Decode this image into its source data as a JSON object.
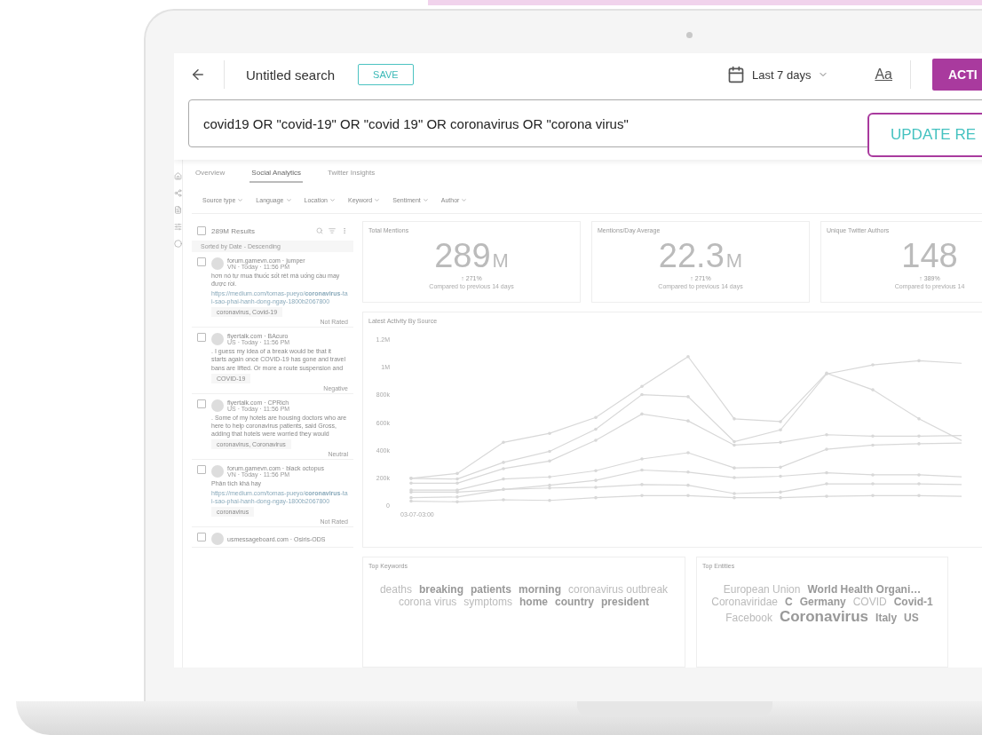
{
  "header": {
    "title": "Untitled search",
    "save_button": "SAVE",
    "date_range": "Last 7 days",
    "font_toggle": "Aa",
    "action_button": "ACTI"
  },
  "query": {
    "value": "covid19 OR \"covid-19\" OR \"covid 19\" OR coronavirus OR \"corona virus\"",
    "update_button": "UPDATE RE"
  },
  "tabs": [
    {
      "label": "Overview",
      "selected": false
    },
    {
      "label": "Social Analytics",
      "selected": true
    },
    {
      "label": "Twitter Insights",
      "selected": false
    }
  ],
  "filters": [
    "Source type",
    "Language",
    "Location",
    "Keyword",
    "Sentiment",
    "Author"
  ],
  "results": {
    "count": "289M Results",
    "checked": false,
    "sort": "Sorted by Date - Descending",
    "posts": [
      {
        "source": "forum.gamevn.com · jumper",
        "meta": "VN · Today · 11:56 PM",
        "text": "hơn nó tự mua thuốc sốt rét mà uống cầu may được rồi.",
        "link": "https://medium.com/tomas-pueyo/**coronavirus**-tai-sao-phai-hanh-dong-ngay-1800b2067800",
        "tags": "coronavirus, Covid-19",
        "sentiment": "Not Rated",
        "checked": false
      },
      {
        "source": "flyertalk.com · BAcuro",
        "meta": "US · Today · 11:56 PM",
        "text": ". I guess my idea of a break would be that it starts again once COVID-19 has gone and travel bans are lifted. Or more a route suspension and",
        "tags": "COVID-19",
        "sentiment": "Negative",
        "checked": false
      },
      {
        "source": "flyertalk.com · CPRich",
        "meta": "US · Today · 11:56 PM",
        "text": ". Some of my hotels are housing doctors who are here to help coronavirus patients, said Gross, adding that hotels were worried they would",
        "tags": "coronavirus, Coronavirus",
        "sentiment": "Neutral",
        "checked": false
      },
      {
        "source": "forum.gamevn.com · black octopus",
        "meta": "VN · Today · 11:56 PM",
        "text": "Phân tích khá hay",
        "link": "https://medium.com/tomas-pueyo/**coronavirus**-tai-sao-phai-hanh-dong-ngay-1800b2067800",
        "tags": "coronavirus",
        "sentiment": "Not Rated",
        "checked": false
      },
      {
        "source": "usmessageboard.com · Osiris-ODS",
        "checked": false
      }
    ]
  },
  "stats": [
    {
      "title": "Total Mentions",
      "value": "289",
      "unit": "M",
      "change": "↑ 271%",
      "note": "Compared to previous 14 days"
    },
    {
      "title": "Mentions/Day Average",
      "value": "22.3",
      "unit": "M",
      "change": "↑ 271%",
      "note": "Compared to previous 14 days"
    },
    {
      "title": "Unique Twitter Authors",
      "value": "148",
      "change": "↑ 389%",
      "note": "Compared to previous 14"
    }
  ],
  "activity": {
    "title": "Latest Activity By Source",
    "first_date": "03-07-03:00",
    "chart_data": {
      "type": "line",
      "ylim": [
        0,
        1200000
      ],
      "yticks": [
        {
          "value": 0,
          "label": "0"
        },
        {
          "value": 200000,
          "label": "200k"
        },
        {
          "value": 400000,
          "label": "400k"
        },
        {
          "value": 600000,
          "label": "600k"
        },
        {
          "value": 800000,
          "label": "800k"
        },
        {
          "value": 1000000,
          "label": "1M"
        },
        {
          "value": 1200000,
          "label": "1.2M"
        }
      ],
      "series": [
        {
          "color": "#d8d8d8",
          "values": [
            200000,
            235000,
            460000,
            525000,
            640000,
            865000,
            1080000,
            630000,
            610000,
            960000,
            840000,
            630000,
            460000
          ]
        },
        {
          "color": "#d8d8d8",
          "values": [
            200000,
            195000,
            315000,
            395000,
            555000,
            805000,
            790000,
            465000,
            550000,
            955000,
            1020000,
            1050000,
            1030000
          ]
        },
        {
          "color": "#d8d8d8",
          "values": [
            165000,
            165000,
            270000,
            325000,
            475000,
            665000,
            615000,
            440000,
            460000,
            515000,
            505000,
            505000,
            510000
          ]
        },
        {
          "color": "#d8d8d8",
          "values": [
            115000,
            115000,
            195000,
            210000,
            255000,
            340000,
            385000,
            275000,
            280000,
            410000,
            440000,
            450000,
            455000
          ]
        },
        {
          "color": "#d8d8d8",
          "values": [
            100000,
            100000,
            120000,
            150000,
            185000,
            260000,
            245000,
            205000,
            215000,
            240000,
            225000,
            225000,
            210000
          ]
        },
        {
          "color": "#d8d8d8",
          "values": [
            60000,
            65000,
            120000,
            130000,
            135000,
            155000,
            150000,
            90000,
            100000,
            160000,
            160000,
            160000,
            155000
          ]
        },
        {
          "color": "#d8d8d8",
          "values": [
            35000,
            30000,
            45000,
            40000,
            60000,
            75000,
            75000,
            60000,
            60000,
            70000,
            75000,
            75000,
            70000
          ]
        }
      ]
    }
  },
  "top_keywords": {
    "title": "Top Keywords",
    "words": [
      {
        "text": "deaths",
        "kind": "light"
      },
      {
        "text": "breaking",
        "kind": "bold"
      },
      {
        "text": "patients",
        "kind": "bold"
      },
      {
        "text": "morning",
        "kind": "bold"
      },
      {
        "text": "coronavirus outbreak",
        "kind": "light"
      },
      {
        "text": "corona virus",
        "kind": "light"
      },
      {
        "text": "symptoms",
        "kind": "light"
      },
      {
        "text": "home",
        "kind": "bold"
      },
      {
        "text": "country",
        "kind": "bold"
      },
      {
        "text": "president",
        "kind": "bold"
      }
    ]
  },
  "top_entities": {
    "title": "Top Entities",
    "words": [
      {
        "text": "European Union",
        "kind": "light"
      },
      {
        "text": "World Health Organi…",
        "kind": "bold"
      },
      {
        "text": "Coronaviridae",
        "kind": "light"
      },
      {
        "text": "C",
        "kind": "bold"
      },
      {
        "text": "Germany",
        "kind": "bold"
      },
      {
        "text": "COVID",
        "kind": "light"
      },
      {
        "text": "Covid-1",
        "kind": "bold"
      },
      {
        "text": "Facebook",
        "kind": "light"
      },
      {
        "text": "Coronavirus",
        "kind": "big"
      },
      {
        "text": "Italy",
        "kind": "bold"
      },
      {
        "text": "US",
        "kind": "bold"
      }
    ]
  }
}
